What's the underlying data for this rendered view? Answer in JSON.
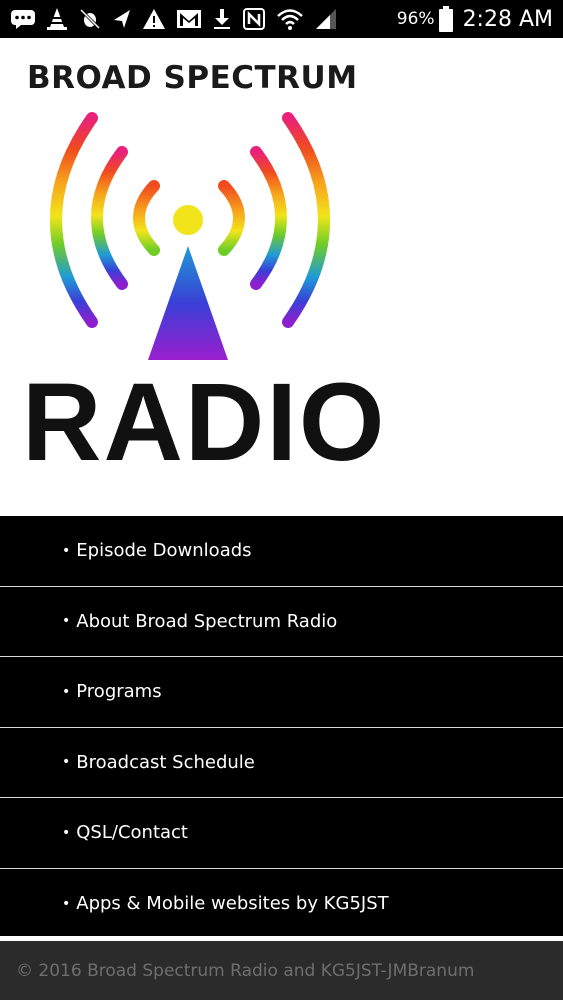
{
  "status_bar": {
    "battery": "96%",
    "time": "2:28 AM",
    "icons": [
      "messages-icon",
      "vlc-cone-icon",
      "no-bug-icon",
      "navigation-arrow-icon",
      "warning-icon",
      "gmail-icon",
      "download-icon",
      "nfc-icon",
      "wifi-icon",
      "cell-signal-icon",
      "battery-icon"
    ]
  },
  "logo": {
    "top_text": "BROAD SPECTRUM",
    "bottom_text": "RADIO",
    "rainbow": [
      "#e8217a",
      "#f04b1e",
      "#f7a51c",
      "#f2e41a",
      "#6fcd28",
      "#1f9ad6",
      "#3a3fd6",
      "#8e1fcf"
    ]
  },
  "nav": {
    "bullet": "•",
    "items": [
      {
        "label": "Episode Downloads"
      },
      {
        "label": "About Broad Spectrum Radio"
      },
      {
        "label": "Programs"
      },
      {
        "label": "Broadcast Schedule"
      },
      {
        "label": "QSL/Contact"
      },
      {
        "label": "Apps & Mobile websites by KG5JST"
      }
    ]
  },
  "footer": {
    "text": "© 2016 Broad Spectrum Radio and KG5JST-JMBranum"
  }
}
